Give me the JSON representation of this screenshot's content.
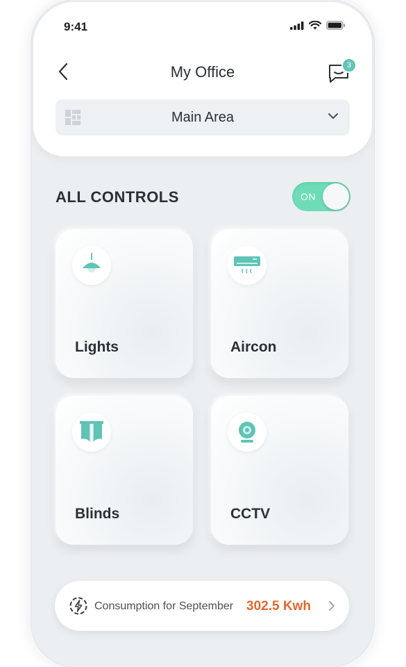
{
  "status_bar": {
    "time": "9:41"
  },
  "header": {
    "title": "My Office",
    "notification_count": "3"
  },
  "area_selector": {
    "selected": "Main Area"
  },
  "controls": {
    "section_title": "ALL CONTROLS",
    "master_toggle": {
      "label": "ON",
      "state": "on"
    },
    "tiles": [
      {
        "label": "Lights",
        "icon": "pendant-lamp-icon"
      },
      {
        "label": "Aircon",
        "icon": "air-conditioner-icon"
      },
      {
        "label": "Blinds",
        "icon": "blinds-icon"
      },
      {
        "label": "CCTV",
        "icon": "camera-icon"
      }
    ]
  },
  "consumption": {
    "label": "Consumption for September",
    "value": "302.5 Kwh",
    "value_color": "#e5672c"
  },
  "colors": {
    "accent": "#5fc4b6",
    "toggle_on": "#6ddcb7"
  }
}
